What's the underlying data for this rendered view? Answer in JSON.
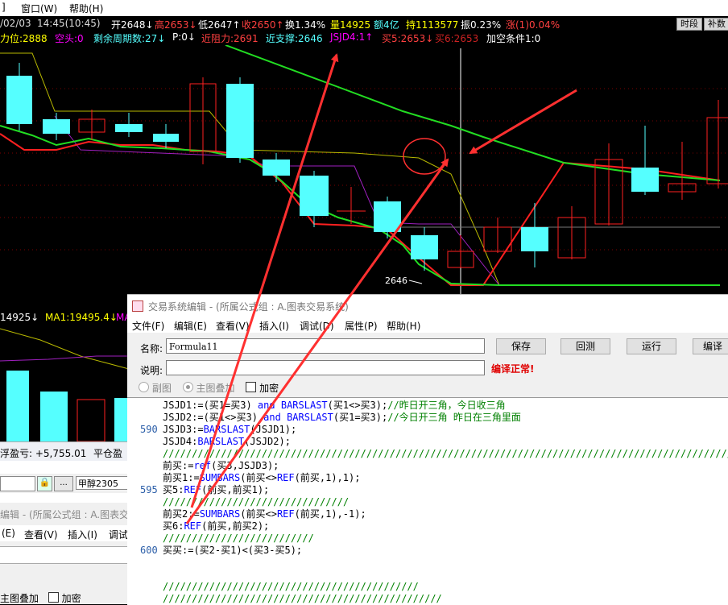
{
  "menubar": {
    "items": [
      "]",
      "窗口(W)",
      "帮助(H)"
    ]
  },
  "quote": {
    "date": "/02/03",
    "time": "14:45(10:45)",
    "open": "开2648↓",
    "high": "高2653↓",
    "low": "低2647↑",
    "close": "收2650↑",
    "turnover": "换1.34%",
    "volume": "量14925",
    "amount": "额4亿",
    "holding": "持1113577",
    "amplitude": "振0.23%",
    "change": "涨(1)0.04%",
    "btn_timeframe": "时段",
    "btn_supplement": "补数"
  },
  "indicators": {
    "power": "力位:2888",
    "short_head": "空头:0",
    "remaining": "剩余周期数:27↓",
    "p": "P:0↓",
    "resistance": "近阻力:2691",
    "support": "近支撑:2646",
    "jsjd4": "JSJD4:1↑",
    "buy5": "买5:2653↓",
    "buy6": "买6:2653",
    "condition": "加空条件1:0"
  },
  "chart_main": {
    "low_label": "2646"
  },
  "volume_pane": {
    "vol": "14925↓",
    "ma1": "MA1:19495.4↓",
    "ma_cut": "MA"
  },
  "pnl": {
    "floating": "浮盈亏: +5,755.01",
    "closing": "平仓盈"
  },
  "order_controls": {
    "contract": "甲醇2305",
    "dots": "..."
  },
  "editor2": {
    "title": "编辑 - (所属公式组 : A.图表交",
    "menu": [
      "(E)",
      "查看(V)",
      "插入(I)",
      "调试"
    ],
    "overlay_label": "主图叠加",
    "encrypt_label": "加密"
  },
  "dialog": {
    "title": "交易系统编辑 - (所属公式组 : A.图表交易系统)",
    "menu": [
      "文件(F)",
      "编辑(E)",
      "查看(V)",
      "插入(I)",
      "调试(D)",
      "属性(P)",
      "帮助(H)"
    ],
    "name_label": "名称:",
    "name_value": "Formula11",
    "desc_label": "说明:",
    "desc_value": "",
    "btn_save": "保存",
    "btn_backtest": "回测",
    "btn_run": "运行",
    "btn_compile": "编译",
    "status": "编译正常!",
    "radio_sub": "副图",
    "radio_main": "主图叠加",
    "check_encrypt": "加密",
    "gutter": [
      "590",
      "595",
      "600"
    ],
    "code_lines": [
      [
        [
          "JSJD1:=(买1=买3) ",
          ""
        ],
        [
          "and",
          "kw"
        ],
        [
          " ",
          ""
        ],
        [
          "BARSLAST",
          "kw"
        ],
        [
          "(买1<>买3);",
          ""
        ],
        [
          "//昨日开三角，今日收三角",
          "cm"
        ]
      ],
      [
        [
          "JSJD2:=(买1<>买3) ",
          ""
        ],
        [
          "and",
          "kw"
        ],
        [
          " ",
          ""
        ],
        [
          "BARSLAST",
          "kw"
        ],
        [
          "(买1=买3);",
          ""
        ],
        [
          "//今日开三角 昨日在三角里面",
          "cm"
        ]
      ],
      [
        [
          "JSJD3:=",
          ""
        ],
        [
          "BARSLAST",
          "kw"
        ],
        [
          "(JSJD1);",
          ""
        ]
      ],
      [
        [
          "JSJD4:",
          ""
        ],
        [
          "BARSLAST",
          "kw"
        ],
        [
          "(JSJD2);",
          ""
        ]
      ],
      [
        [
          "/////////////////////////////////////////////////////////////////////////////////////////////////////",
          "cm"
        ]
      ],
      [
        [
          "前买:=",
          ""
        ],
        [
          "ref",
          "kw"
        ],
        [
          "(买3,JSJD3);",
          ""
        ]
      ],
      [
        [
          "前买1:=",
          ""
        ],
        [
          "SUMBARS",
          "kw"
        ],
        [
          "(前买<>",
          ""
        ],
        [
          "REF",
          "kw"
        ],
        [
          "(前买,1),1);",
          ""
        ]
      ],
      [
        [
          "买5:",
          ""
        ],
        [
          "REF",
          "kw"
        ],
        [
          "(前买,前买1);",
          ""
        ]
      ],
      [
        [
          "////////////////////////////////",
          "cm"
        ]
      ],
      [
        [
          "前买2:=",
          ""
        ],
        [
          "SUMBARS",
          "kw"
        ],
        [
          "(前买<>",
          ""
        ],
        [
          "REF",
          "kw"
        ],
        [
          "(前买,1),-1);",
          ""
        ]
      ],
      [
        [
          "买6:",
          ""
        ],
        [
          "REF",
          "kw"
        ],
        [
          "(前买,前买2);",
          ""
        ]
      ],
      [
        [
          "//////////////////////////",
          "cm"
        ]
      ],
      [
        [
          "买买:=(买2-买1)<(买3-买5);",
          ""
        ]
      ],
      [
        [
          "",
          ""
        ]
      ],
      [
        [
          "",
          ""
        ]
      ],
      [
        [
          "////////////////////////////////////////////",
          "cm"
        ]
      ],
      [
        [
          "////////////////////////////////////////////////",
          "cm"
        ]
      ]
    ]
  }
}
